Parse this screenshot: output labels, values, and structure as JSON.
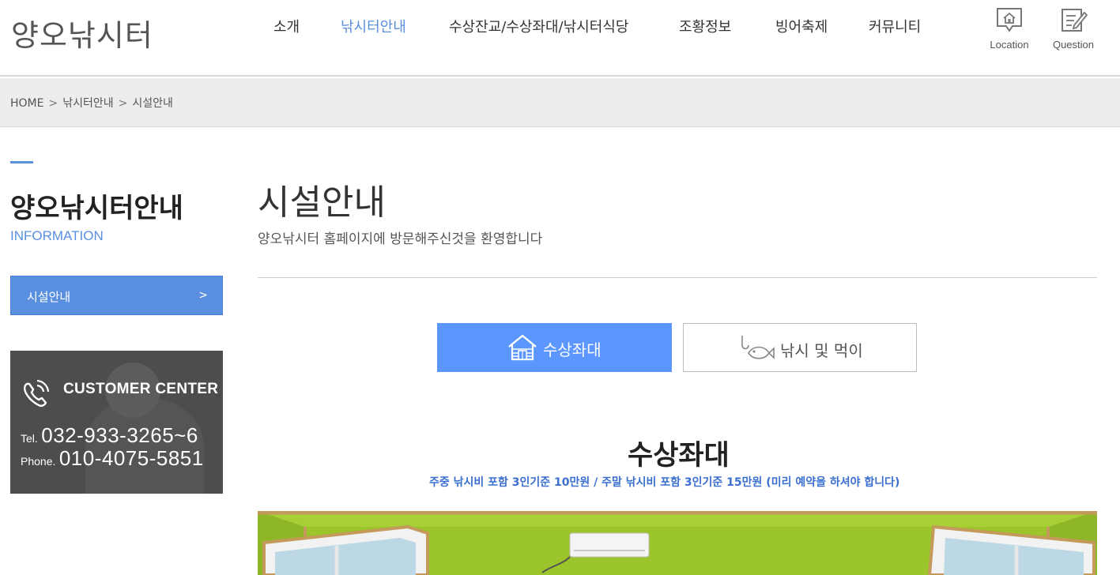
{
  "header": {
    "logo": "양오낚시터",
    "nav": [
      {
        "label": "소개",
        "active": false
      },
      {
        "label": "낚시터안내",
        "active": true
      },
      {
        "label": "수상잔교/수상좌대/낚시터식당",
        "active": false
      },
      {
        "label": "조황정보",
        "active": false
      },
      {
        "label": "빙어축제",
        "active": false
      },
      {
        "label": "커뮤니티",
        "active": false
      }
    ],
    "icons": [
      {
        "label": "Location",
        "icon": "house-location-icon"
      },
      {
        "label": "Question",
        "icon": "note-pencil-icon"
      }
    ]
  },
  "breadcrumb": {
    "items": [
      "HOME",
      "낚시터안내",
      "시설안내"
    ],
    "separator": ">"
  },
  "sidebar": {
    "title": "양오낚시터안내",
    "subtitle": "INFORMATION",
    "menu": [
      {
        "label": "시설안내",
        "arrow": ">"
      }
    ],
    "customer_center": {
      "title": "CUSTOMER CENTER",
      "tel_label": "Tel.",
      "tel": "032-933-3265~6",
      "phone_label": "Phone.",
      "phone": "010-4075-5851"
    }
  },
  "main": {
    "title": "시설안내",
    "description": "양오낚시터 홈페이지에 방문해주신것을 환영합니다",
    "tabs": [
      {
        "label": "수상좌대",
        "icon": "house-icon",
        "active": true
      },
      {
        "label": "낚시 및 먹이",
        "icon": "fish-hook-icon",
        "active": false
      }
    ],
    "section_title": "수상좌대",
    "section_note": "주중 낚시비 포함 3인기준 10만원 / 주말 낚시비 포함 3인기준 15만원 (미리 예약을 하셔야 합니다)"
  },
  "colors": {
    "accent": "#5a8fe0",
    "tab_active": "#5b97ff",
    "note_text": "#3a6fd0",
    "breadcrumb_bg": "#ededed",
    "customer_center_bg": "#4d4d4d",
    "photo_wall": "#98bf2a"
  }
}
